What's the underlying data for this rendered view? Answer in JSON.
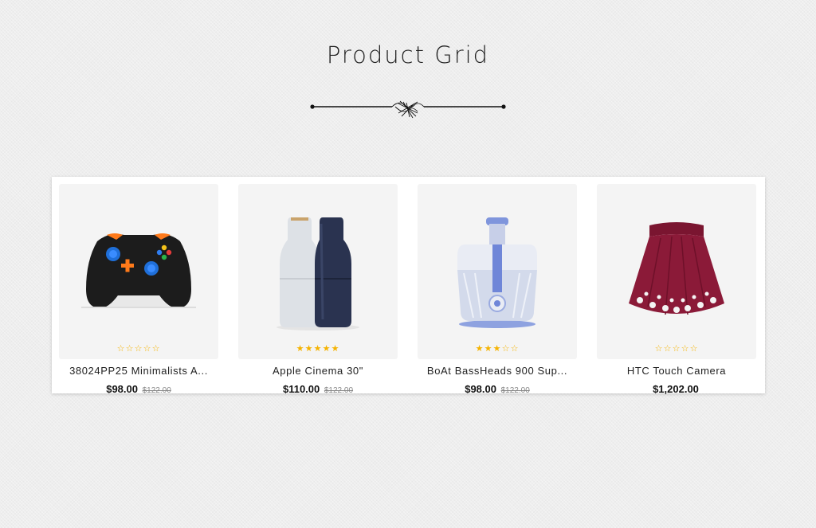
{
  "section": {
    "title": "Product Grid"
  },
  "products": [
    {
      "name": "38024PP25 Minimalists A...",
      "price": "$98.00",
      "old_price": "$122.00",
      "rating": 0,
      "image_icon": "game-controller-icon"
    },
    {
      "name": "Apple Cinema 30\"",
      "price": "$110.00",
      "old_price": "$122.00",
      "rating": 5,
      "image_icon": "salt-pepper-grinder-icon"
    },
    {
      "name": "BoAt BassHeads 900 Sup...",
      "price": "$98.00",
      "old_price": "$122.00",
      "rating": 3,
      "image_icon": "juicer-icon"
    },
    {
      "name": "HTC Touch Camera",
      "price": "$1,202.00",
      "old_price": "",
      "rating": 0,
      "image_icon": "skirt-icon"
    }
  ],
  "colors": {
    "star": "#f5b301",
    "thumb_bg": "#f4f4f4"
  }
}
